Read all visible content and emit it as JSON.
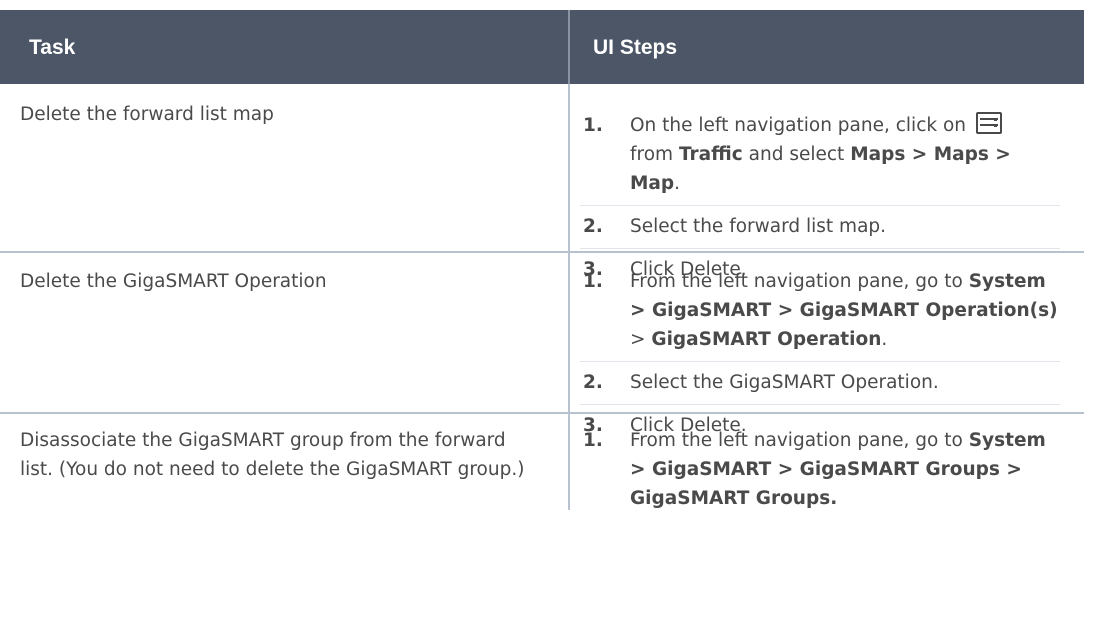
{
  "table": {
    "headers": {
      "task": "Task",
      "steps": "UI Steps"
    },
    "rows": [
      {
        "task": "Delete the forward list map",
        "steps": [
          {
            "num": "1.",
            "parts": [
              "On the left navigation pane, click on",
              "from",
              "Traffic",
              "and select",
              "Maps > Maps > Map",
              "."
            ],
            "icon": "storage-list-icon"
          },
          {
            "num": "2.",
            "text": "Select the forward list map."
          },
          {
            "num": "3.",
            "text": "Click Delete."
          }
        ]
      },
      {
        "task": "Delete the GigaSMART Operation",
        "steps": [
          {
            "num": "1.",
            "parts": [
              "From the left navigation pane, go to",
              "System > GigaSMART > GigaSMART Operation(s)",
              ">",
              "GigaSMART Operation",
              "."
            ]
          },
          {
            "num": "2.",
            "text": "Select the GigaSMART Operation."
          },
          {
            "num": "3.",
            "text": "Click Delete."
          }
        ]
      },
      {
        "task": "Disassociate the GigaSMART group from the forward list. (You do not need to delete the GigaSMART group.)",
        "steps": [
          {
            "num": "1.",
            "parts": [
              "From the left navigation pane, go to",
              "System > GigaSMART > GigaSMART Groups > GigaSMART Groups."
            ]
          }
        ]
      }
    ]
  }
}
